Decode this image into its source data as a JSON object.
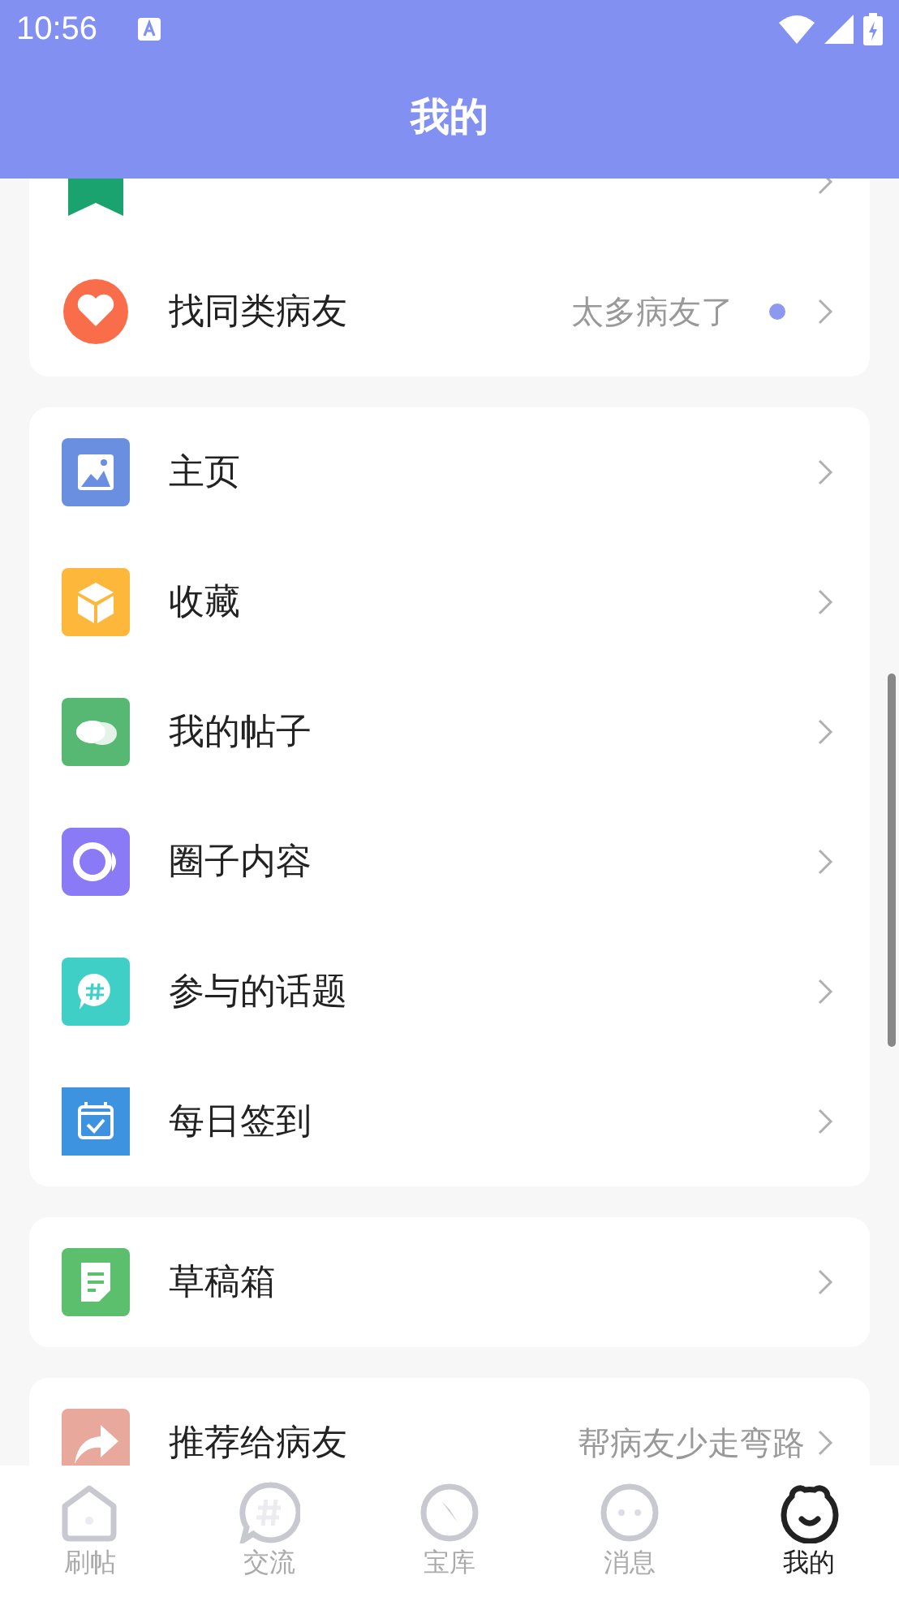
{
  "status_bar": {
    "time": "10:56"
  },
  "header": {
    "title": "我的"
  },
  "groups": [
    {
      "items": [
        {
          "unread": false
        },
        {
          "label": "找同类病友",
          "detail": "太多病友了",
          "unread": true
        }
      ]
    },
    {
      "items": [
        {
          "label": "主页",
          "unread": false
        },
        {
          "label": "收藏",
          "unread": false
        },
        {
          "label": "我的帖子",
          "unread": false
        },
        {
          "label": "圈子内容",
          "unread": false
        },
        {
          "label": "参与的话题",
          "unread": false
        },
        {
          "label": "每日签到",
          "unread": false
        }
      ]
    },
    {
      "items": [
        {
          "label": "草稿箱",
          "unread": false
        }
      ]
    },
    {
      "items": [
        {
          "label": "推荐给病友",
          "detail": "帮病友少走弯路",
          "unread": false
        }
      ]
    }
  ],
  "bottom_nav": [
    {
      "label": "刷帖",
      "selected": false
    },
    {
      "label": "交流",
      "selected": false
    },
    {
      "label": "宝库",
      "selected": false
    },
    {
      "label": "消息",
      "selected": false
    },
    {
      "label": "我的",
      "selected": true
    }
  ]
}
